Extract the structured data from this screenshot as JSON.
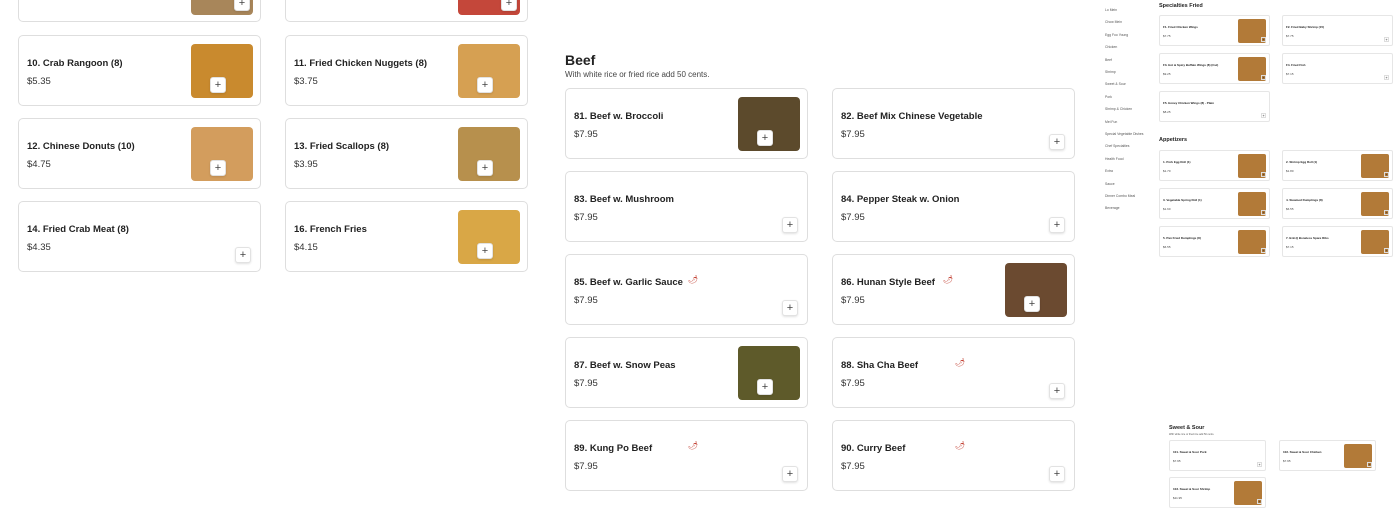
{
  "left_items": [
    {
      "name": "10. Crab Rangoon (8)",
      "price": "$5.35",
      "photo": true
    },
    {
      "name": "11. Fried Chicken Nuggets (8)",
      "price": "$3.75",
      "photo": true
    },
    {
      "name": "12. Chinese Donuts (10)",
      "price": "$4.75",
      "photo": true
    },
    {
      "name": "13. Fried Scallops (8)",
      "price": "$3.95",
      "photo": true
    },
    {
      "name": "14. Fried Crab Meat (8)",
      "price": "$4.35",
      "photo": false
    },
    {
      "name": "16. French Fries",
      "price": "$4.15",
      "photo": true
    }
  ],
  "beef": {
    "title": "Beef",
    "subtitle": "With white rice or fried rice add 50 cents.",
    "items": [
      {
        "name": "81. Beef w. Broccoli",
        "price": "$7.95",
        "photo": true,
        "spicy": false
      },
      {
        "name": "82. Beef Mix Chinese Vegetable",
        "price": "$7.95",
        "photo": false,
        "spicy": false
      },
      {
        "name": "83. Beef w. Mushroom",
        "price": "$7.95",
        "photo": false,
        "spicy": false
      },
      {
        "name": "84. Pepper Steak w. Onion",
        "price": "$7.95",
        "photo": false,
        "spicy": false
      },
      {
        "name": "85. Beef w. Garlic Sauce",
        "price": "$7.95",
        "photo": false,
        "spicy": true
      },
      {
        "name": "86. Hunan Style Beef",
        "price": "$7.95",
        "photo": true,
        "spicy": true
      },
      {
        "name": "87. Beef w. Snow Peas",
        "price": "$7.95",
        "photo": true,
        "spicy": false
      },
      {
        "name": "88. Sha Cha Beef",
        "price": "$7.95",
        "photo": false,
        "spicy": true
      },
      {
        "name": "89. Kung Po Beef",
        "price": "$7.95",
        "photo": false,
        "spicy": true
      },
      {
        "name": "90. Curry Beef",
        "price": "$7.95",
        "photo": false,
        "spicy": true
      }
    ]
  },
  "icons": {
    "plus": "+",
    "chili": "🌶"
  },
  "preview": {
    "nav": [
      "Lo Mein",
      "Chow Mein",
      "Egg Foo Young",
      "Chicken",
      "Beef",
      "Shrimp",
      "Sweet & Sour",
      "Pork",
      "Shrimp & Chicken",
      "Mei Fun",
      "Special Vegetable Dishes",
      "Chef Specialties",
      "Health Food",
      "Extra",
      "Sauce",
      "Dinner Combo Meal",
      "Beverage"
    ],
    "specialties_title": "Specialties Fried",
    "specialties": [
      {
        "name": "F1. Fried Chicken Wings",
        "price": "$7.75",
        "photo": true
      },
      {
        "name": "F2. Fried Baby Shrimp (15)",
        "price": "$7.75",
        "photo": false
      },
      {
        "name": "F3. Hot & Spicy Buffalo Wings (8) (Cut)",
        "price": "$9.25",
        "photo": true
      },
      {
        "name": "F4. Fried Fish",
        "price": "$7.15",
        "photo": false
      },
      {
        "name": "F5. Honey Chicken Wings (8) · Plain",
        "price": "$8.25",
        "photo": false
      }
    ],
    "appetizers_title": "Appetizers",
    "appetizers": [
      {
        "name": "1. Pork Egg Roll (1)",
        "price": "$1.70",
        "photo": true
      },
      {
        "name": "2. Shrimp Egg Roll (1)",
        "price": "$1.80",
        "photo": true
      },
      {
        "name": "3. Vegetable Spring Roll (1)",
        "price": "$1.60",
        "photo": true
      },
      {
        "name": "4. Steamed Dumplings (8)",
        "price": "$6.55",
        "photo": true
      },
      {
        "name": "5. Pan Fried Dumplings (8)",
        "price": "$6.55",
        "photo": true
      },
      {
        "name": "7. B-B-Q Boneless Spare Ribs",
        "price": "$7.15",
        "photo": true
      }
    ],
    "sweet_title": "Sweet & Sour",
    "sweet_subtitle": "With white rice or fried rice add 50 cents.",
    "sweet": [
      {
        "name": "101. Sweet & Sour Pork",
        "price": "$7.95",
        "photo": false
      },
      {
        "name": "102. Sweet & Sour Chicken",
        "price": "$7.95",
        "photo": true
      },
      {
        "name": "103. Sweet & Sour Shrimp",
        "price": "$11.95",
        "photo": true
      }
    ]
  }
}
